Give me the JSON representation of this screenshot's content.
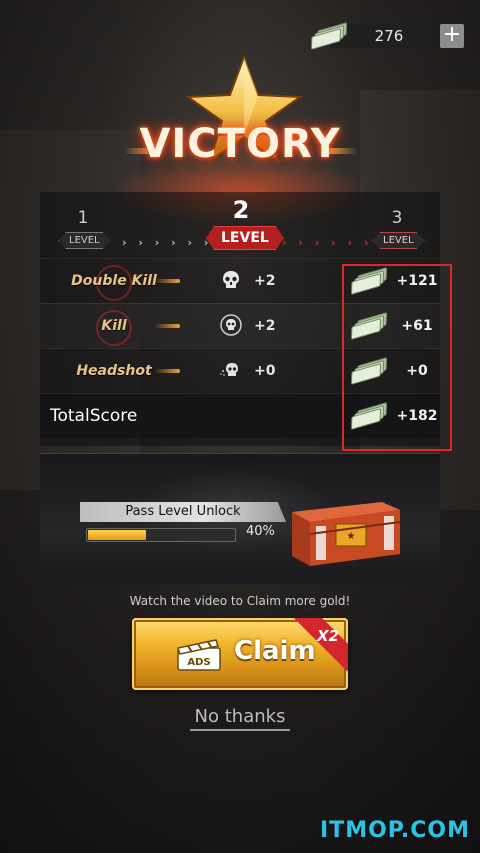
{
  "currency": {
    "amount": "276",
    "plus_label": "+",
    "icon": "cash-icon"
  },
  "banner": {
    "title": "VICTORY",
    "icon": "star-icon"
  },
  "levels": {
    "prev": {
      "number": "1",
      "tag": "LEVEL"
    },
    "current": {
      "number": "2",
      "tag": "LEVEL"
    },
    "next": {
      "number": "3",
      "tag": "LEVEL"
    },
    "arrows_done": "› › › › › ›",
    "arrows_todo": "› › › › › ›"
  },
  "rows": [
    {
      "label": "Double Kill",
      "bonus": "+2",
      "gold": "+121"
    },
    {
      "label": "Kill",
      "bonus": "+2",
      "gold": "+61"
    },
    {
      "label": "Headshot",
      "bonus": "+0",
      "gold": "+0"
    }
  ],
  "total": {
    "label": "TotalScore",
    "gold": "+182"
  },
  "unlock": {
    "title": "Pass Level Unlock",
    "percent_label": "40%",
    "progress": 0.4
  },
  "watch_text": "Watch the video to Claim more gold!",
  "claim": {
    "label": "Claim",
    "badge": "X2",
    "ads_label": "ADS"
  },
  "no_thanks": "No thanks",
  "watermark": "ITMOP.COM",
  "colors": {
    "accent_red": "#e0262a",
    "gold": "#f3b62f"
  }
}
